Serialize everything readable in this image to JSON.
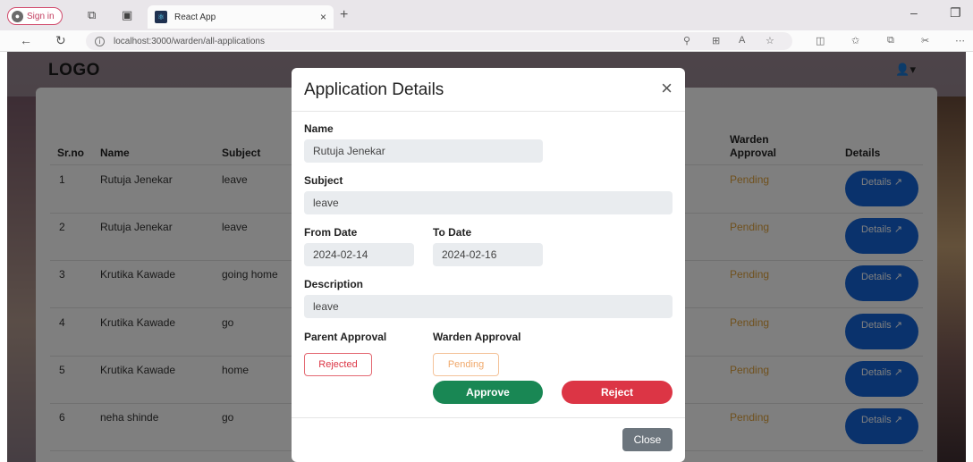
{
  "browser": {
    "signin_label": "Sign in",
    "tab_title": "React App",
    "tab_close": "×",
    "new_tab": "+",
    "url": "localhost:3000/warden/all-applications"
  },
  "navbar": {
    "logo": "LOGO"
  },
  "table": {
    "headers": {
      "srno": "Sr.no",
      "name": "Name",
      "subject": "Subject",
      "warden_approval": "Warden Approval",
      "details": "Details"
    },
    "details_label": "Details ↗",
    "rows": [
      {
        "srno": "1",
        "name": "Rutuja Jenekar",
        "subject": "leave",
        "warden": "Pending"
      },
      {
        "srno": "2",
        "name": "Rutuja Jenekar",
        "subject": "leave",
        "warden": "Pending"
      },
      {
        "srno": "3",
        "name": "Krutika Kawade",
        "subject": "going home",
        "warden": "Pending"
      },
      {
        "srno": "4",
        "name": "Krutika Kawade",
        "subject": "go",
        "warden": "Pending"
      },
      {
        "srno": "5",
        "name": "Krutika Kawade",
        "subject": "home",
        "warden": "Pending"
      },
      {
        "srno": "6",
        "name": "neha shinde",
        "subject": "go",
        "warden": "Pending"
      }
    ]
  },
  "modal": {
    "title": "Application Details",
    "close_icon": "×",
    "name_label": "Name",
    "name_value": "Rutuja Jenekar",
    "subject_label": "Subject",
    "subject_value": "leave",
    "from_label": "From Date",
    "from_value": "2024-02-14",
    "to_label": "To Date",
    "to_value": "2024-02-16",
    "desc_label": "Description",
    "desc_value": "leave",
    "parent_label": "Parent Approval",
    "parent_status": "Rejected",
    "warden_label": "Warden Approval",
    "warden_status": "Pending",
    "approve_label": "Approve",
    "reject_label": "Reject",
    "close_label": "Close"
  },
  "colors": {
    "approve": "#198754",
    "reject": "#dc3545",
    "details_button": "#1565d8",
    "pending_text": "#e0a23b"
  }
}
